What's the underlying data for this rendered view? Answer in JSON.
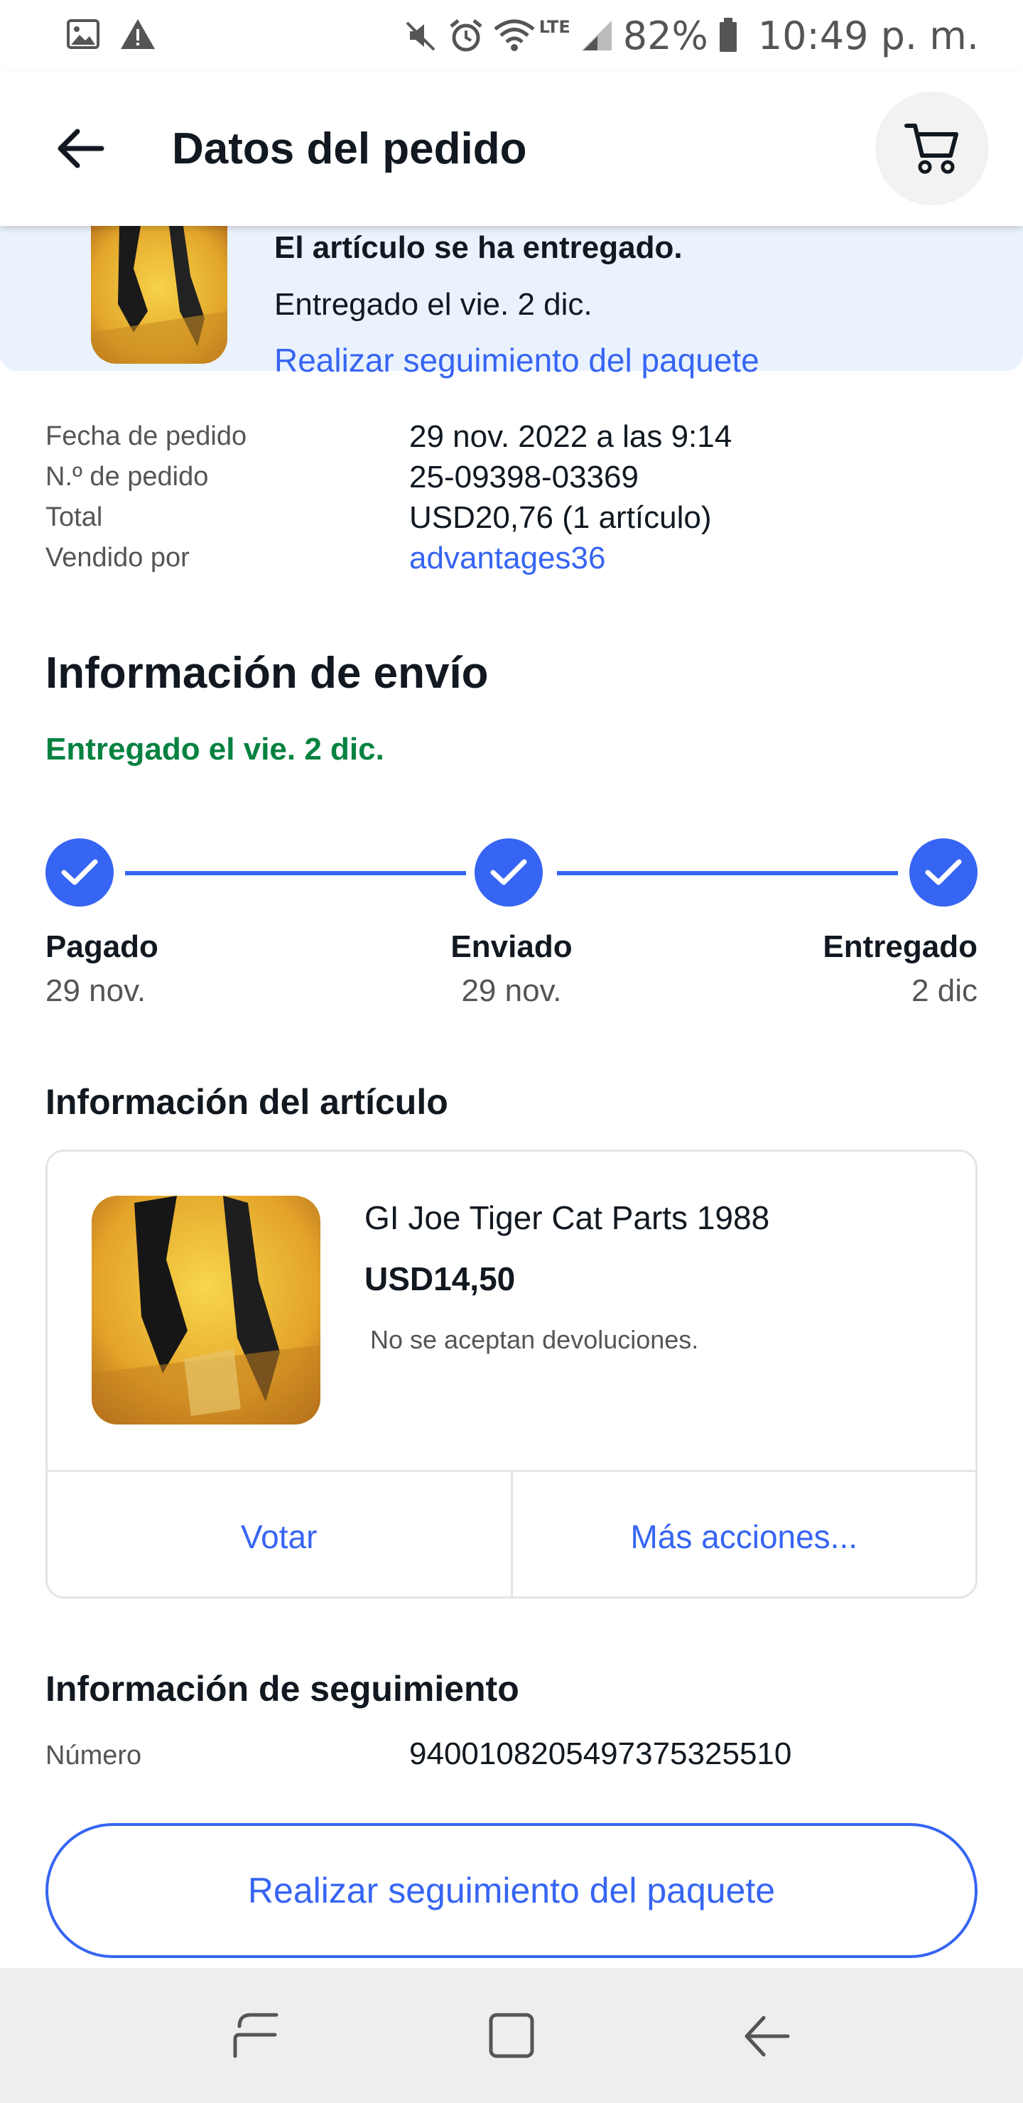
{
  "status_bar": {
    "battery": "82%",
    "time": "10:49 p. m.",
    "network": "LTE",
    "icons": [
      "image-icon",
      "warning-icon",
      "mute-icon",
      "alarm-icon",
      "wifi-icon",
      "signal-icon",
      "battery-icon"
    ]
  },
  "app_bar": {
    "title": "Datos del pedido",
    "icons": [
      "back-arrow-icon",
      "cart-icon"
    ]
  },
  "banner": {
    "title": "El artículo se ha entregado.",
    "subtitle": "Entregado el vie. 2 dic.",
    "link": "Realizar seguimiento del paquete"
  },
  "order_details": [
    {
      "label": "Fecha de pedido",
      "value": "29 nov. 2022 a las 9:14",
      "is_link": false
    },
    {
      "label": "N.º de pedido",
      "value": "25-09398-03369",
      "is_link": false
    },
    {
      "label": "Total",
      "value": "USD20,76 (1 artículo)",
      "is_link": false
    },
    {
      "label": "Vendido por",
      "value": "advantages36",
      "is_link": true
    }
  ],
  "shipping": {
    "title": "Información de envío",
    "status": "Entregado el vie. 2 dic.",
    "steps": [
      {
        "label": "Pagado",
        "date": "29 nov."
      },
      {
        "label": "Enviado",
        "date": "29 nov."
      },
      {
        "label": "Entregado",
        "date": "2 dic"
      }
    ]
  },
  "item": {
    "section_title": "Información del artículo",
    "name": "GI Joe Tiger Cat Parts 1988",
    "price": "USD14,50",
    "returns": "No se aceptan devoluciones.",
    "actions": [
      "Votar",
      "Más acciones..."
    ]
  },
  "tracking": {
    "title": "Información de seguimiento",
    "number_label": "Número",
    "number": "9400108205497375325510",
    "button": "Realizar seguimiento del paquete"
  },
  "colors": {
    "accent": "#3665f3",
    "success": "#05823f",
    "banner_bg": "#eaf2fd"
  },
  "nav_bar": {
    "icons": [
      "recents-icon",
      "home-icon",
      "back-icon"
    ]
  }
}
